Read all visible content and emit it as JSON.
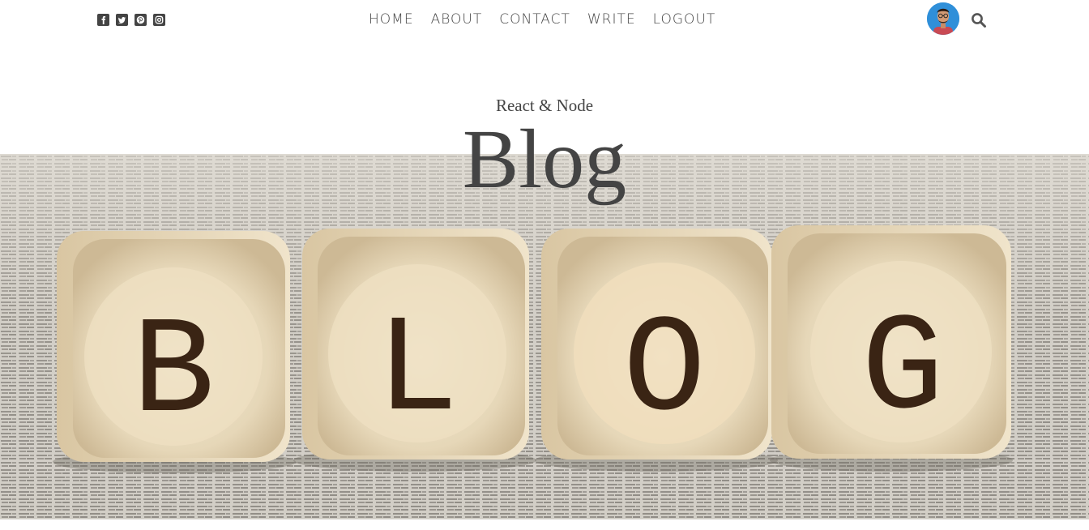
{
  "nav": {
    "items": [
      {
        "label": "HOME"
      },
      {
        "label": "ABOUT"
      },
      {
        "label": "CONTACT"
      },
      {
        "label": "WRITE"
      },
      {
        "label": "LOGOUT"
      }
    ]
  },
  "social": [
    "facebook-square-icon",
    "twitter-square-icon",
    "pinterest-square-icon",
    "instagram-square-icon"
  ],
  "header": {
    "subtitle": "React & Node",
    "title": "Blog"
  },
  "hero": {
    "blocks": [
      "B",
      "L",
      "O",
      "G"
    ]
  },
  "colors": {
    "text": "#444444",
    "block_letter": "#3a2414",
    "wood": "#e8dcc3"
  }
}
